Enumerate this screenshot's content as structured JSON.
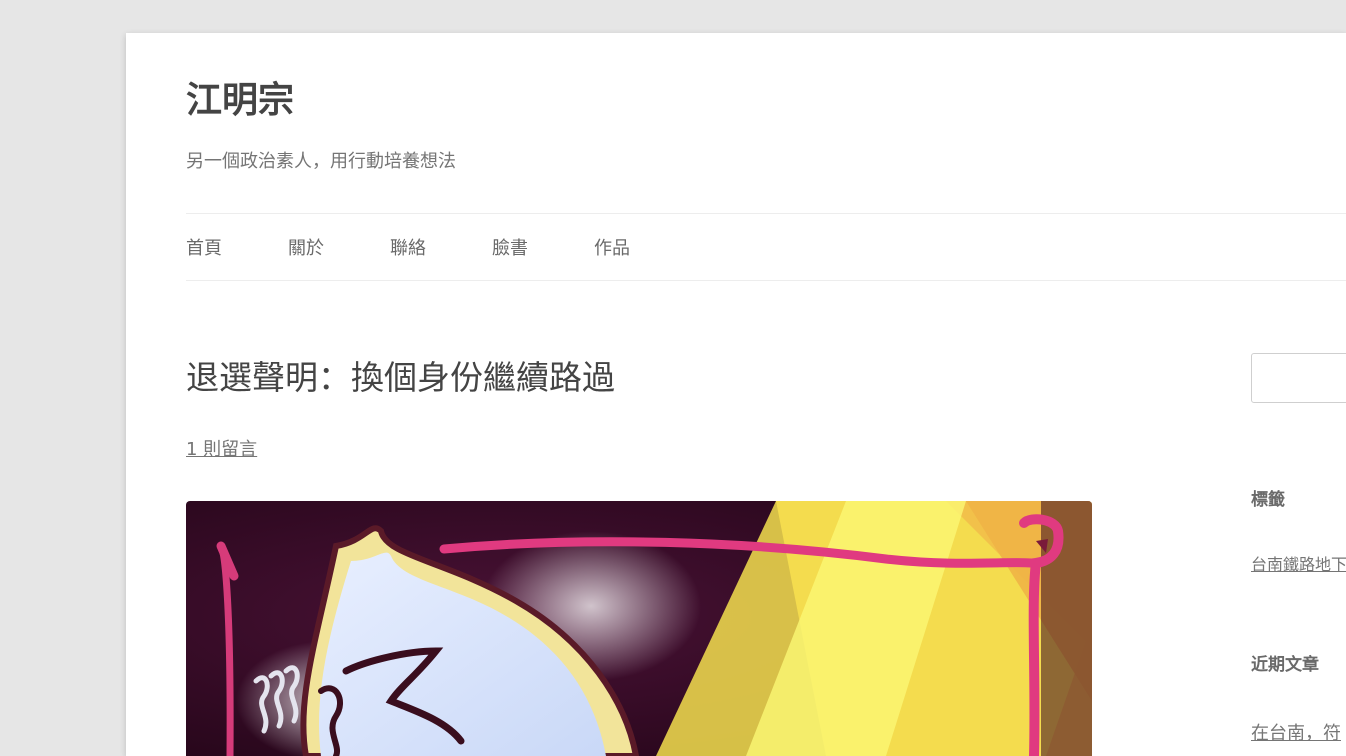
{
  "site": {
    "title": "江明宗",
    "description": "另一個政治素人，用行動培養想法"
  },
  "nav": {
    "items": [
      {
        "label": "首頁"
      },
      {
        "label": "關於"
      },
      {
        "label": "聯絡"
      },
      {
        "label": "臉書"
      },
      {
        "label": "作品"
      }
    ]
  },
  "post": {
    "title": "退選聲明：換個身份繼續路過",
    "comments_link": "1 則留言"
  },
  "sidebar": {
    "tags_title": "標籤",
    "tag_link": "台南鐵路地下",
    "recent_title": "近期文章",
    "recent_link": "在台南，符"
  },
  "colors": {
    "background": "#e6e6e6",
    "page": "#ffffff",
    "title_text": "#444444",
    "muted_text": "#757575"
  }
}
